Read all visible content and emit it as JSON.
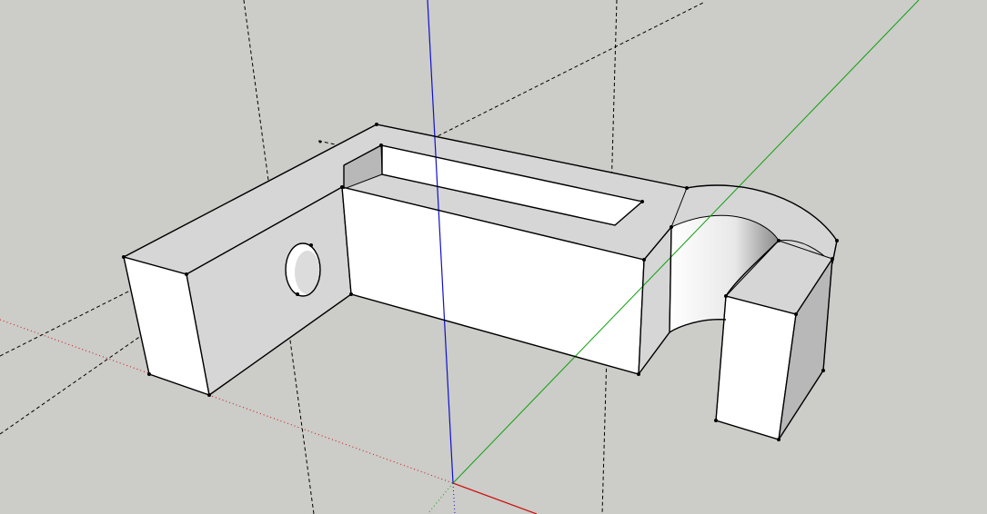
{
  "app": {
    "kind": "3d-modeling-viewport",
    "background_color": "#ccccc8"
  },
  "axes": {
    "x_axis_color": "#cc1010",
    "y_axis_color": "#10a010",
    "z_axis_color": "#1010cc"
  },
  "model": {
    "description_visible": false,
    "face_light_color": "#ffffff",
    "face_mid_color": "#d6d6d6",
    "face_dark_color": "#b8b8b8",
    "edge_color": "#000000"
  },
  "guides": {
    "style": "dashed",
    "color": "#000000"
  }
}
